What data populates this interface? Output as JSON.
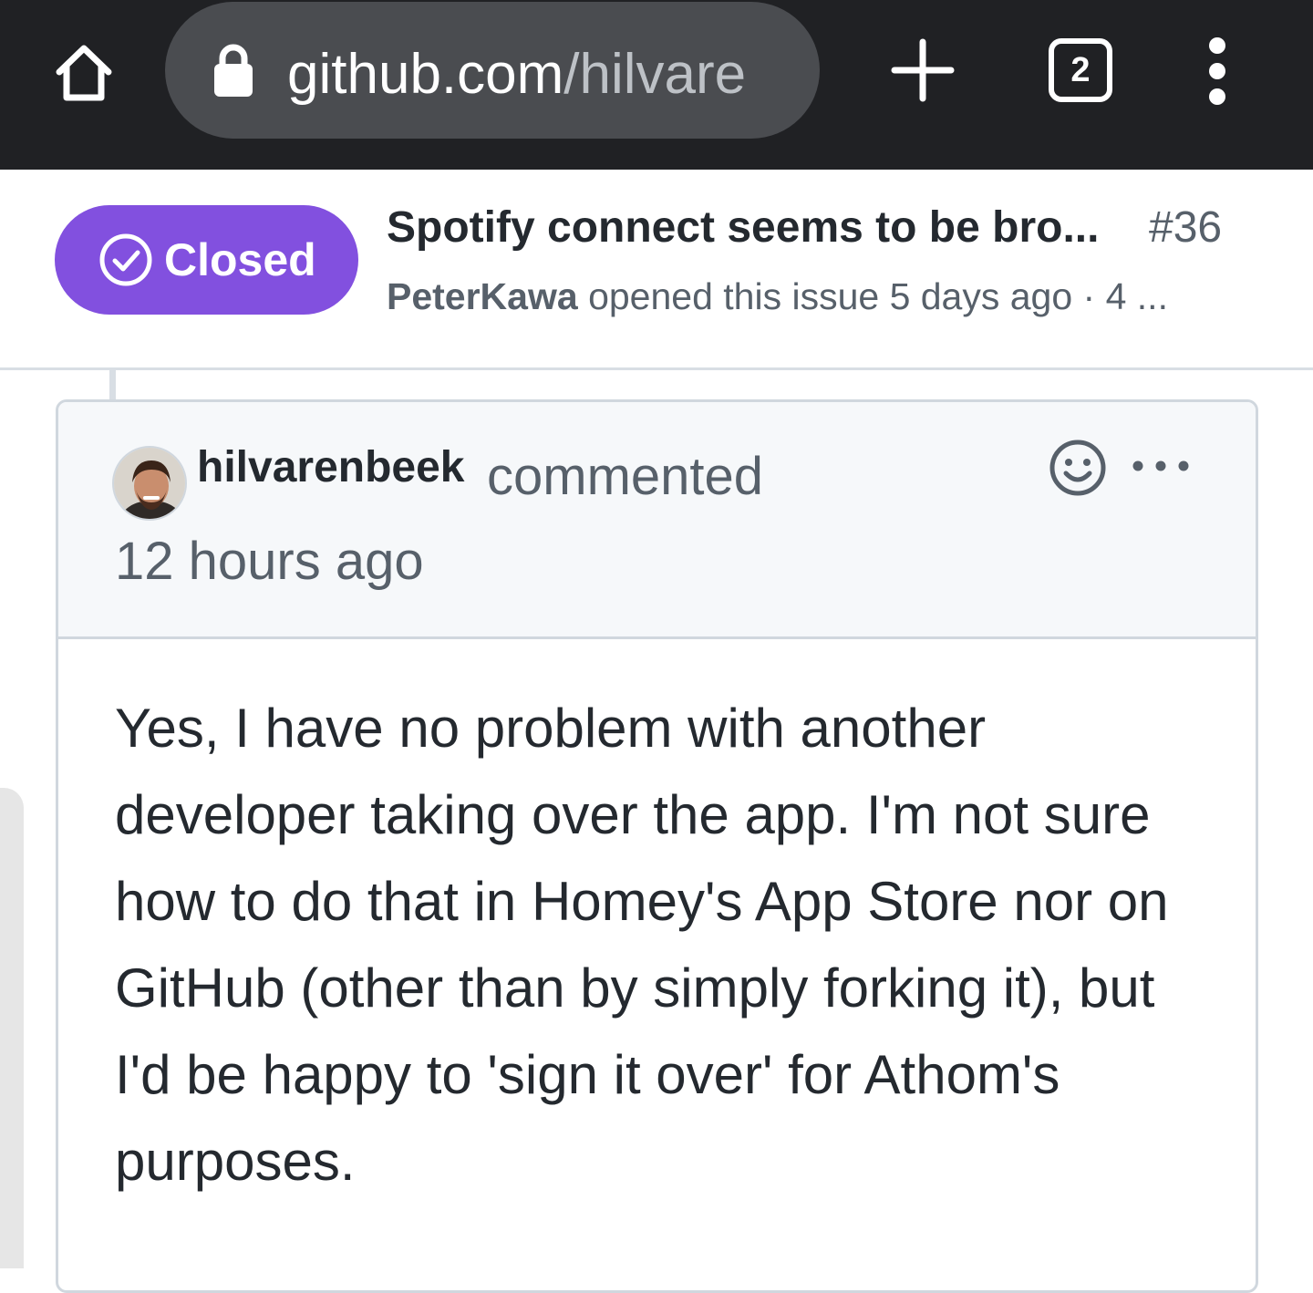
{
  "browser": {
    "url_domain": "github.com",
    "url_path": "/hilvare",
    "tab_count": "2",
    "icons": {
      "home": "home-icon",
      "lock": "lock-icon",
      "new_tab": "plus-icon",
      "menu": "kebab-menu-icon"
    }
  },
  "issue": {
    "state": "Closed",
    "state_color": "#8250df",
    "title": "Spotify connect seems to be bro...",
    "number": "#36",
    "author": "PeterKawa",
    "meta": " opened this issue 5 days ago · 4 ..."
  },
  "comment": {
    "author": "hilvarenbeek",
    "action": "commented",
    "time": "12 hours ago",
    "body": "Yes, I have no problem with another developer taking over the app. I'm not sure how to do that in Homey's App Store nor on GitHub (other than by simply forking it), but I'd be happy to 'sign it over' for Athom's purposes."
  },
  "colors": {
    "toolbar_bg": "#202124",
    "url_bar_bg": "#4a4c50",
    "text_primary": "#24292f",
    "text_muted": "#57606a",
    "border": "#d0d7de",
    "comment_header_bg": "#f6f8fa"
  }
}
